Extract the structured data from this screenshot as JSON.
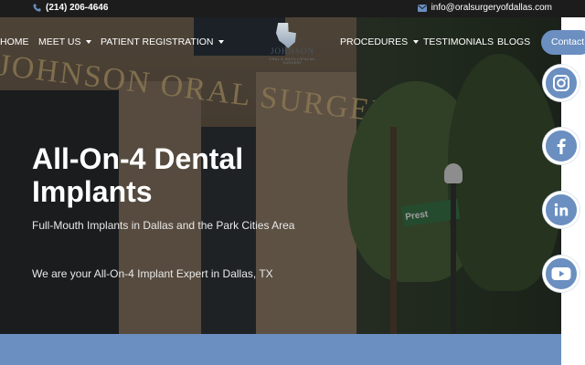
{
  "topbar": {
    "phone": "(214) 206-4646",
    "email": "info@oralsurgeryofdallas.com",
    "phone_icon": "phone-icon",
    "email_icon": "envelope-icon"
  },
  "nav": {
    "items": [
      {
        "label": "HOME",
        "has_dropdown": false
      },
      {
        "label": "MEET US",
        "has_dropdown": true
      },
      {
        "label": "PATIENT REGISTRATION",
        "has_dropdown": true
      },
      {
        "label": "PROCEDURES",
        "has_dropdown": true
      },
      {
        "label": "TESTIMONIALS",
        "has_dropdown": false
      },
      {
        "label": "BLOGS",
        "has_dropdown": false
      }
    ],
    "contact_label": "Contact",
    "logo": {
      "name": "JOHNSON",
      "tagline": "ORAL & MAXILLOFACIAL SURGERY"
    }
  },
  "hero": {
    "background_sign": "JOHNSON ORAL SURGERY",
    "street_sign": "Prest",
    "title": "All-On-4 Dental Implants",
    "subtitle": "Full-Mouth Implants in Dallas and the Park Cities Area",
    "expert_line": "We are your All-On-4 Implant Expert in Dallas, TX"
  },
  "social": [
    {
      "name": "instagram",
      "icon": "instagram-icon"
    },
    {
      "name": "facebook",
      "icon": "facebook-icon"
    },
    {
      "name": "linkedin",
      "icon": "linkedin-icon"
    },
    {
      "name": "youtube",
      "icon": "youtube-icon"
    }
  ],
  "colors": {
    "accent": "#6a8fc0",
    "topbar": "#1c1c1c",
    "text_light": "#ffffff"
  }
}
